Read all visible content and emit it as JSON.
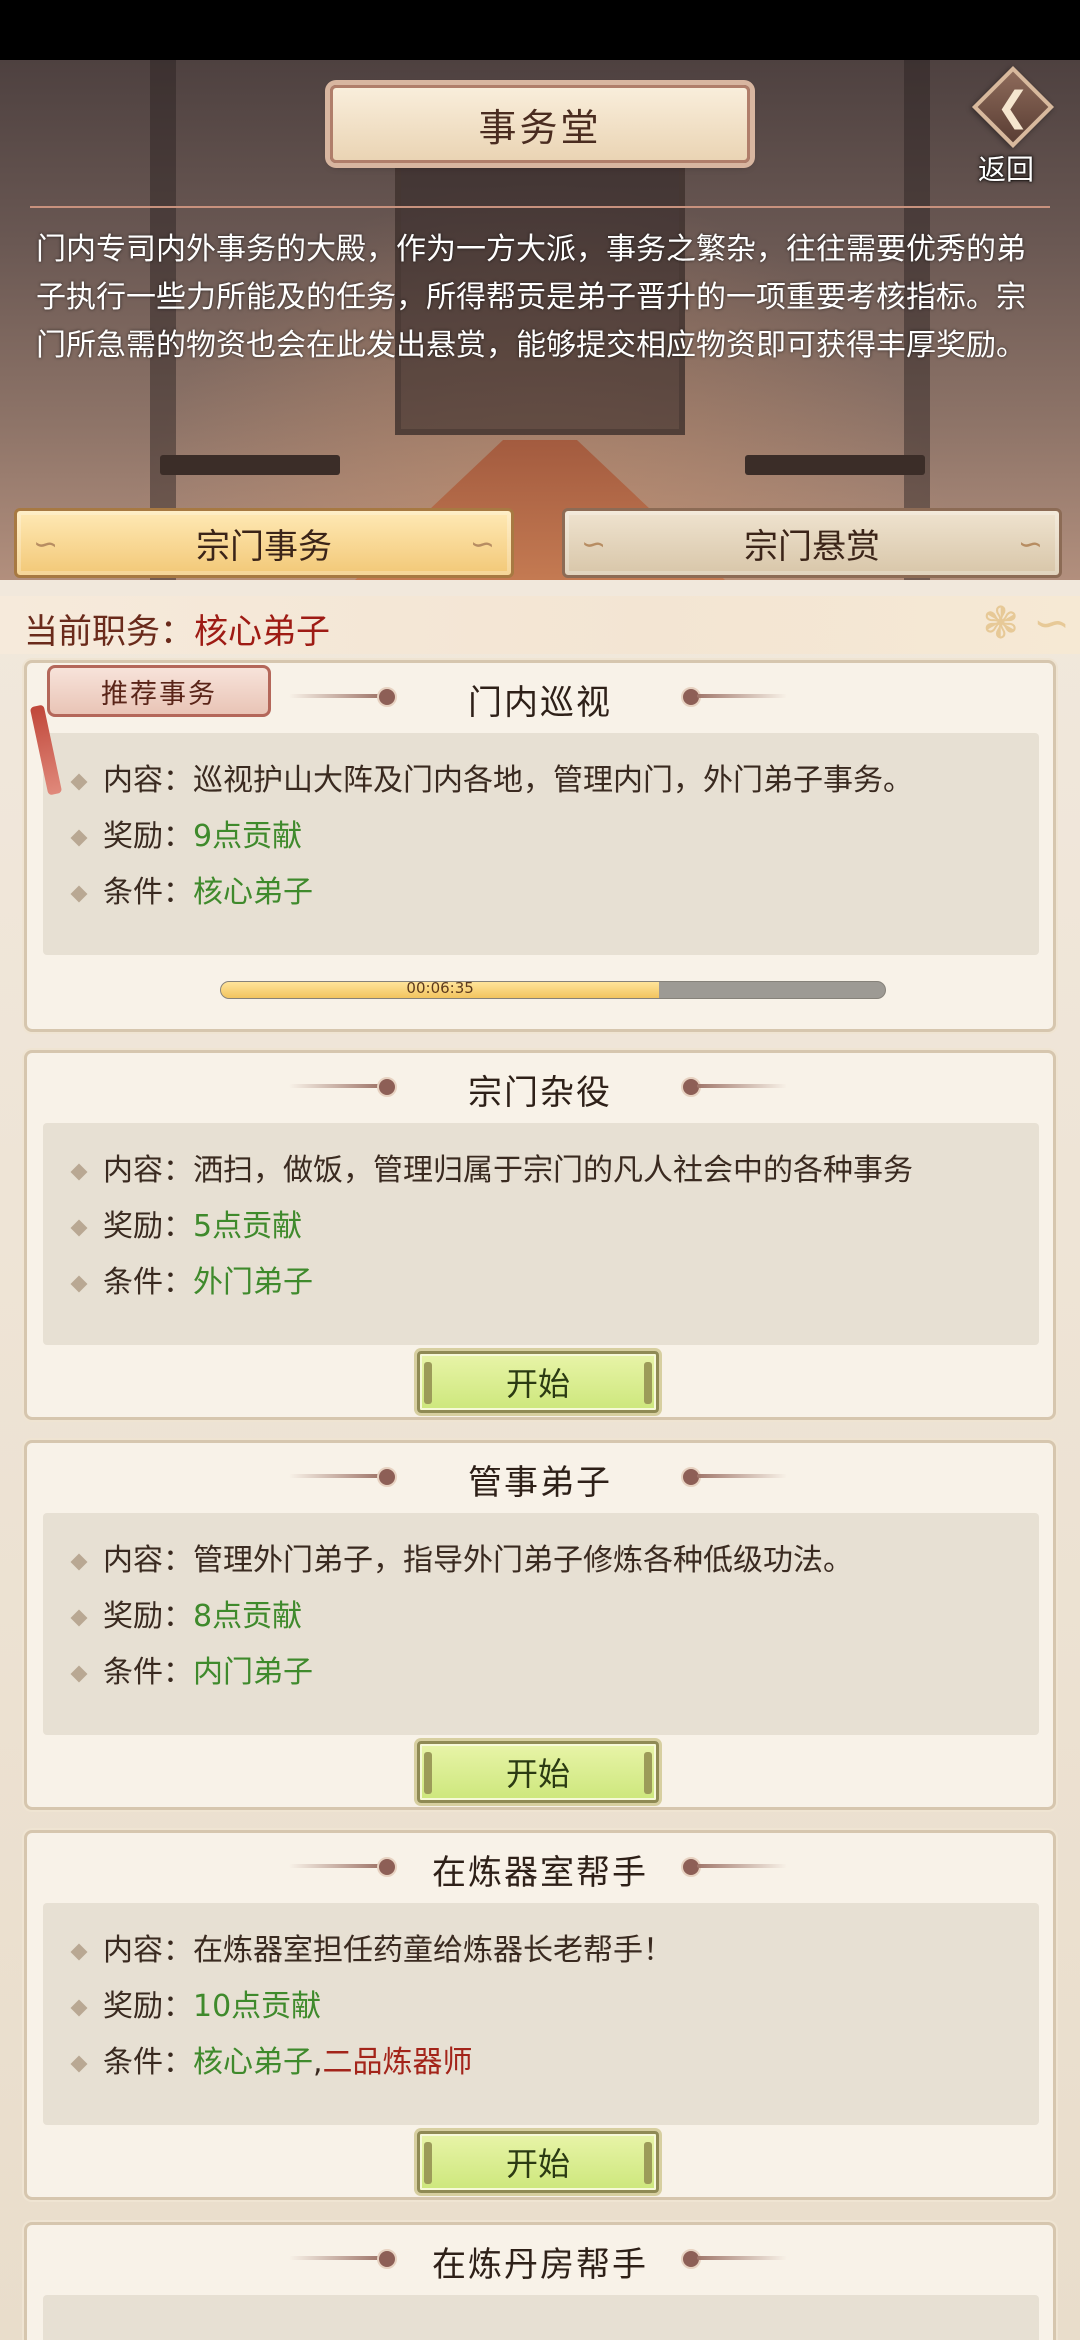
{
  "header": {
    "title": "事务堂",
    "back_label": "返回",
    "description": "门内专司内外事务的大殿，作为一方大派，事务之繁杂，往往需要优秀的弟子执行一些力所能及的任务，所得帮贡是弟子晋升的一项重要考核指标。宗门所急需的物资也会在此发出悬赏，能够提交相应物资即可获得丰厚奖励。"
  },
  "tabs": [
    {
      "label": "宗门事务",
      "active": true
    },
    {
      "label": "宗门悬赏",
      "active": false
    }
  ],
  "role": {
    "label": "当前职务：",
    "value": "核心弟子"
  },
  "recommend_tag": "推荐事务",
  "labels": {
    "content": "内容：",
    "reward": "奖励：",
    "condition": "条件："
  },
  "tasks": [
    {
      "title": "门内巡视",
      "content": "巡视护山大阵及门内各地，管理内门，外门弟子事务。",
      "reward": "9点贡献",
      "condition": "核心弟子",
      "progress_text": "00:06:35",
      "progress": 0.66
    },
    {
      "title": "宗门杂役",
      "content": "洒扫，做饭，管理归属于宗门的凡人社会中的各种事务",
      "reward": "5点贡献",
      "condition": "外门弟子",
      "button": "开始"
    },
    {
      "title": "管事弟子",
      "content": "管理外门弟子，指导外门弟子修炼各种低级功法。",
      "reward": "8点贡献",
      "condition": "内门弟子",
      "button": "开始"
    },
    {
      "title": "在炼器室帮手",
      "content": "在炼器室担任药童给炼器长老帮手！",
      "reward": "10点贡献",
      "condition": "核心弟子",
      "condition_extra": "二品炼器师",
      "condition_sep": ",",
      "button": "开始"
    },
    {
      "title": "在炼丹房帮手"
    }
  ],
  "colors": {
    "green_text": "#3f8a2c",
    "red_text": "#a3241a",
    "active_tab": "#f2c877"
  }
}
